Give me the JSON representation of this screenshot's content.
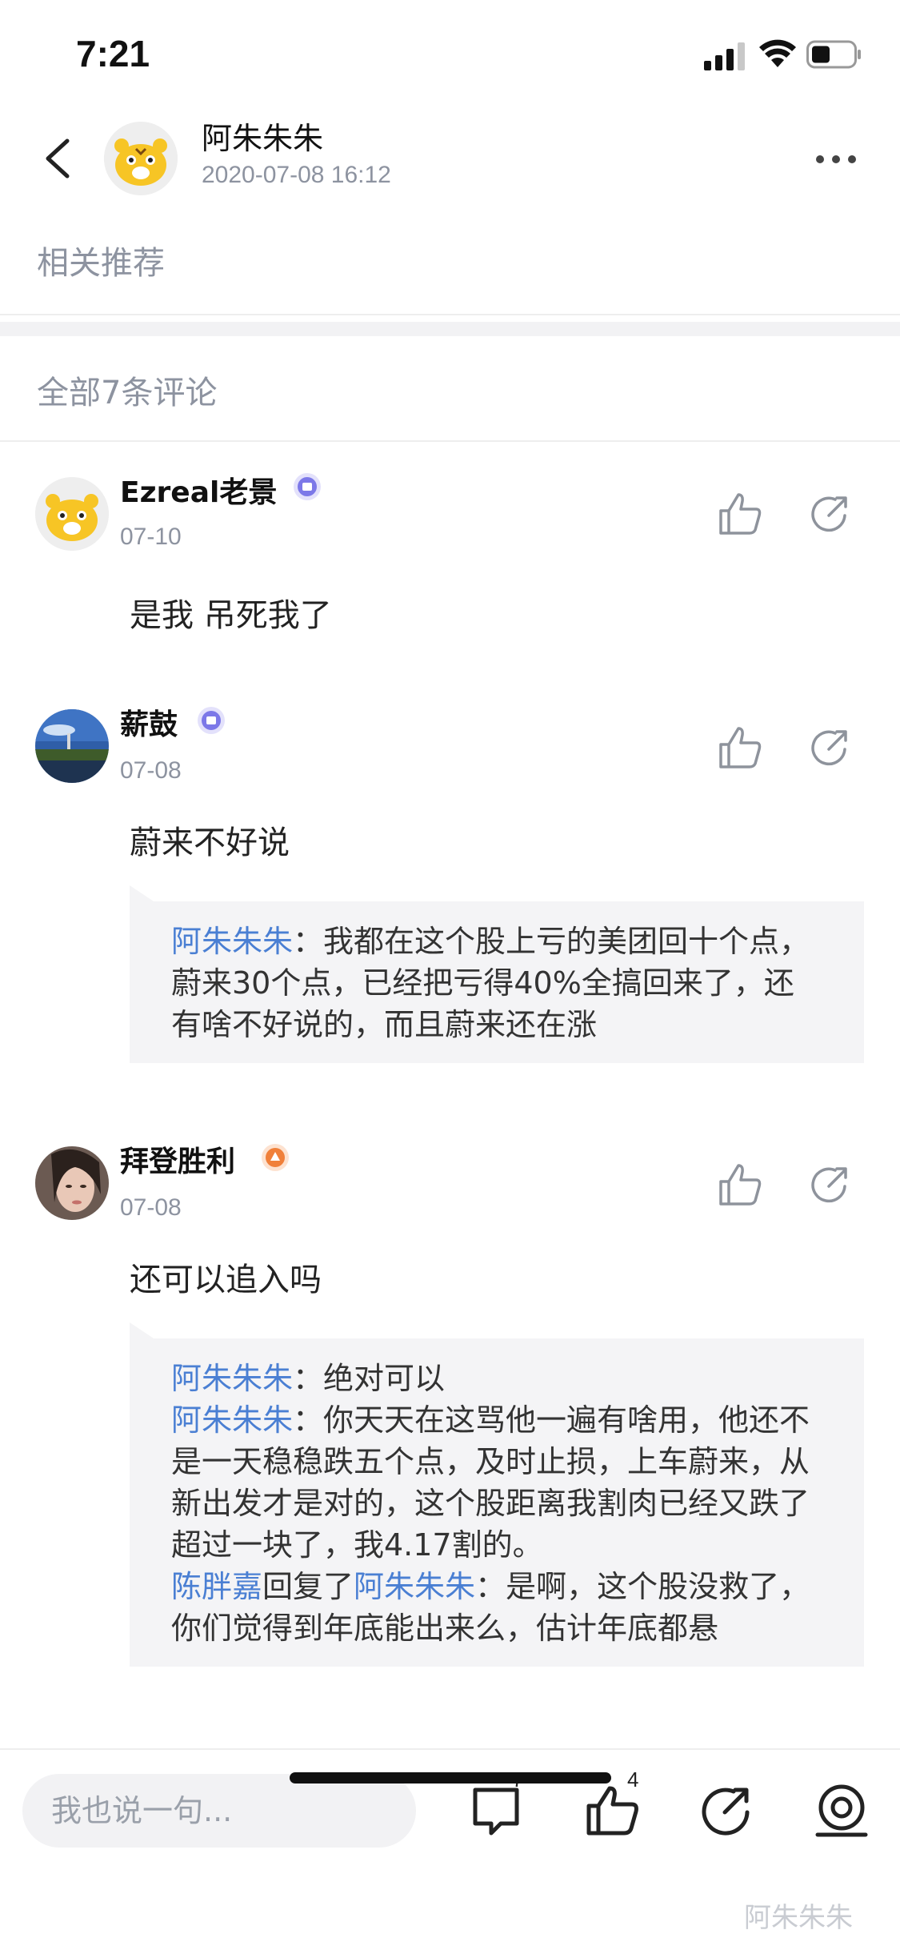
{
  "status_bar": {
    "time": "7:21"
  },
  "header": {
    "author_name": "阿朱朱朱",
    "post_time": "2020-07-08 16:12"
  },
  "related_label": "相关推荐",
  "comment_count_label": "全部7条评论",
  "comments": [
    {
      "name": "Ezreal老景",
      "date": "07-10",
      "text": "是我 吊死我了",
      "badge_color": "#7c78e8",
      "replies": []
    },
    {
      "name": "薪鼓",
      "date": "07-08",
      "text": "蔚来不好说",
      "badge_color": "#7c78e8",
      "replies": [
        {
          "user": "阿朱朱朱",
          "sep": "：",
          "text": "我都在这个股上亏的美团回十个点，蔚来30个点，已经把亏得40%全搞回来了，还有啥不好说的，而且蔚来还在涨"
        }
      ]
    },
    {
      "name": "拜登胜利",
      "date": "07-08",
      "text": "还可以追入吗",
      "badge_color": "#f0803a",
      "replies": [
        {
          "user": "阿朱朱朱",
          "sep": "：",
          "text": "绝对可以"
        },
        {
          "user": "阿朱朱朱",
          "sep": "：",
          "text": "你天天在这骂他一遍有啥用，他还不是一天稳稳跌五个点，及时止损，上车蔚来，从新出发才是对的，这个股距离我割肉已经又跌了超过一块了，我4.17割的。"
        },
        {
          "user": "陈胖嘉",
          "mid": "回复了",
          "target": "阿朱朱朱",
          "sep": "：",
          "text": "是啊，这个股没救了，你们觉得到年底能出来么，估计年底都悬"
        }
      ]
    }
  ],
  "bottom_bar": {
    "input_placeholder": "我也说一句...",
    "comment_count": "7",
    "like_count": "4"
  },
  "watermark": "阿朱朱朱",
  "colors": {
    "link": "#4a7fd3",
    "muted": "#8d93a0",
    "reply_bg": "#f4f4f6"
  }
}
